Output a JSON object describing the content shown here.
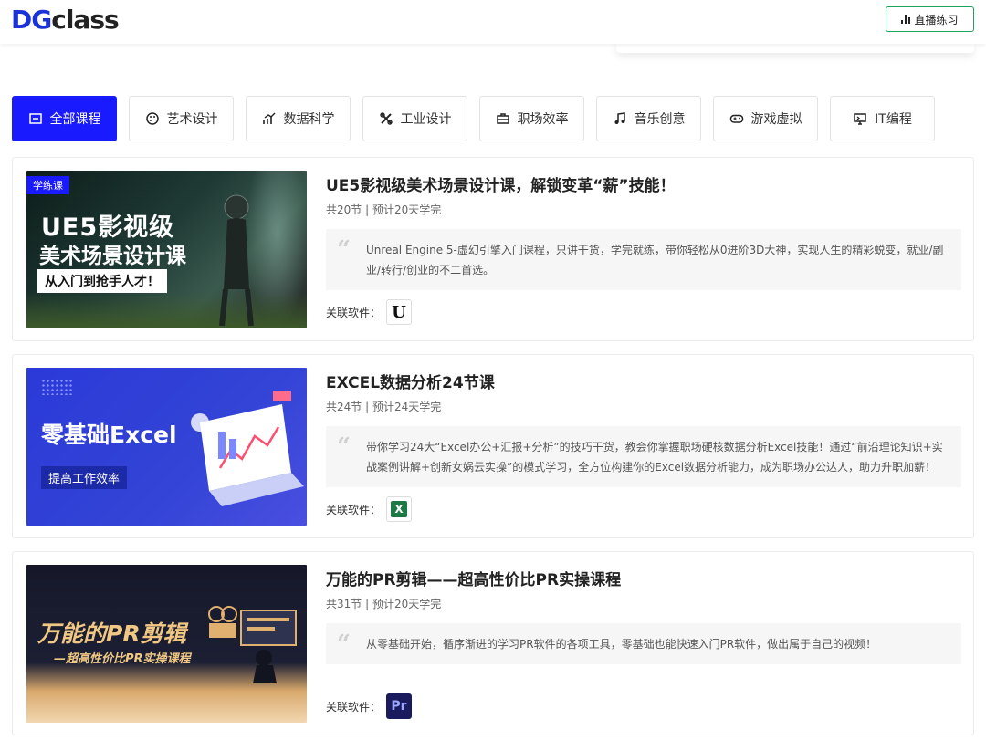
{
  "header": {
    "logo_dg": "DG",
    "logo_class": "class",
    "live_button": "直播练习"
  },
  "tabs": [
    {
      "label": "全部课程",
      "icon": "inbox-icon",
      "active": true
    },
    {
      "label": "艺术设计",
      "icon": "palette-icon",
      "active": false
    },
    {
      "label": "数据科学",
      "icon": "chart-up-icon",
      "active": false
    },
    {
      "label": "工业设计",
      "icon": "tools-icon",
      "active": false
    },
    {
      "label": "职场效率",
      "icon": "briefcase-icon",
      "active": false
    },
    {
      "label": "音乐创意",
      "icon": "music-note-icon",
      "active": false
    },
    {
      "label": "游戏虚拟",
      "icon": "gamepad-icon",
      "active": false
    },
    {
      "label": "IT编程",
      "icon": "monitor-icon",
      "active": false
    }
  ],
  "courses": [
    {
      "title": "UE5影视级美术场景设计课，解锁变革“薪”技能！",
      "meta": "共20节 | 预计20天学完",
      "description": "Unreal Engine 5-虚幻引擎入门课程，只讲干货，学完就练，带你轻松从0进阶3D大神，实现人生的精彩蜕变，就业/副业/转行/创业的不二首选。",
      "software_label": "关联软件：",
      "software": "unreal-engine-icon",
      "thumb": {
        "badge": "学练课",
        "line1": "UE5影视级",
        "line2": "美术场景设计课",
        "line3": "从入门到抢手人才！"
      }
    },
    {
      "title": "EXCEL数据分析24节课",
      "meta": "共24节 | 预计24天学完",
      "description": "带你学习24大“Excel办公+汇报+分析”的技巧干货，教会你掌握职场硬核数据分析Excel技能！通过“前沿理论知识+实战案例讲解+创新女娲云实操”的模式学习，全方位构建你的Excel数据分析能力，成为职场办公达人，助力升职加薪！",
      "software_label": "关联软件：",
      "software": "excel-icon",
      "thumb": {
        "line1": "零基础Excel",
        "line2": "提高工作效率"
      }
    },
    {
      "title": "万能的PR剪辑——超高性价比PR实操课程",
      "meta": "共31节 | 预计20天学完",
      "description": "从零基础开始，循序渐进的学习PR软件的各项工具，零基础也能快速入门PR软件，做出属于自己的视频！",
      "software_label": "关联软件：",
      "software": "premiere-pro-icon",
      "software_text": "Pr",
      "thumb": {
        "line1": "万能的PR剪辑",
        "line2": "—超高性价比PR实操课程"
      }
    }
  ],
  "colors": {
    "accent": "#1a1aff",
    "live_green": "#1aa35a"
  }
}
